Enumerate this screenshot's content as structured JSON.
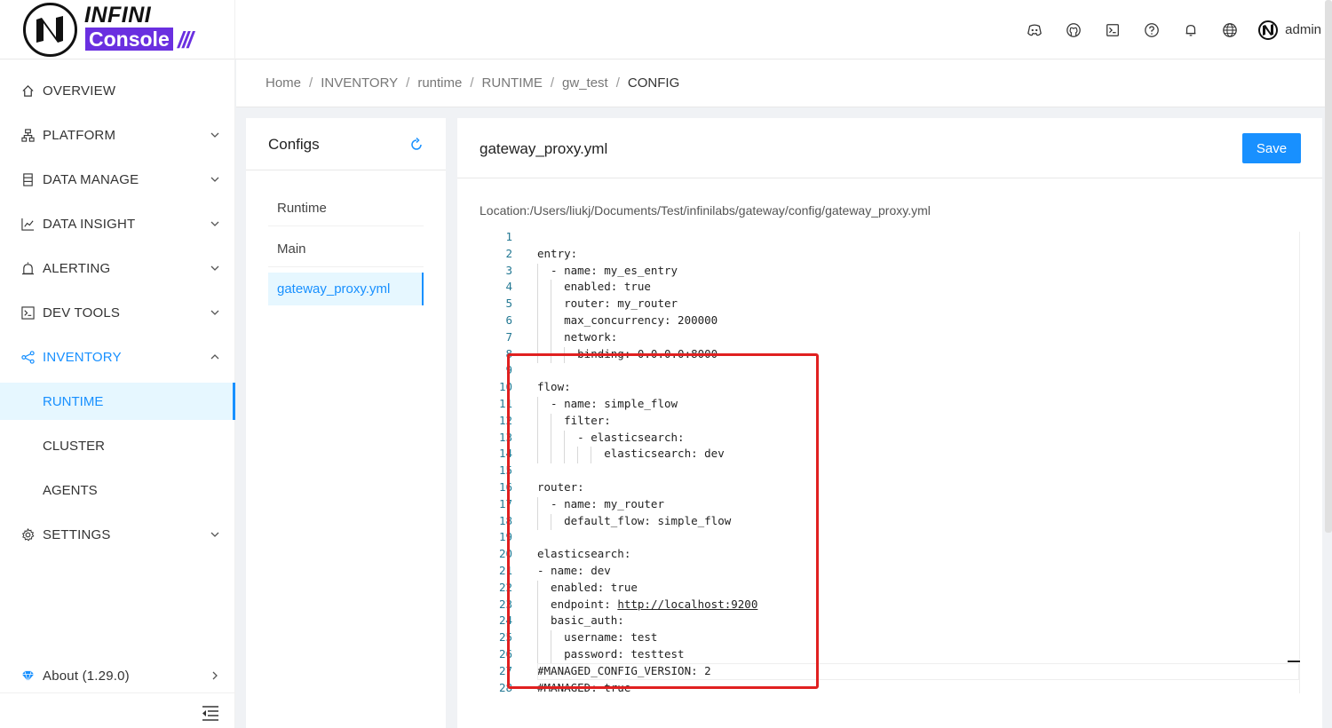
{
  "app": {
    "logo_top": "INFINI",
    "logo_bottom": "Console",
    "logo_slashes": "///"
  },
  "header": {
    "icons": [
      "discord-icon",
      "github-icon",
      "terminal-icon",
      "help-icon",
      "bell-icon",
      "globe-icon"
    ],
    "user": "admin"
  },
  "sidebar": {
    "items": [
      {
        "label": "OVERVIEW",
        "icon": "home-icon"
      },
      {
        "label": "PLATFORM",
        "icon": "cluster-icon"
      },
      {
        "label": "DATA MANAGE",
        "icon": "database-icon"
      },
      {
        "label": "DATA INSIGHT",
        "icon": "chart-icon"
      },
      {
        "label": "ALERTING",
        "icon": "alarm-icon"
      },
      {
        "label": "DEV TOOLS",
        "icon": "code-icon"
      },
      {
        "label": "INVENTORY",
        "icon": "share-icon"
      },
      {
        "label": "SETTINGS",
        "icon": "gear-icon"
      }
    ],
    "inventory_children": [
      "RUNTIME",
      "CLUSTER",
      "AGENTS"
    ],
    "about": "About (1.29.0)"
  },
  "breadcrumb": [
    "Home",
    "INVENTORY",
    "runtime",
    "RUNTIME",
    "gw_test",
    "CONFIG"
  ],
  "configs": {
    "title": "Configs",
    "items": [
      "Runtime",
      "Main",
      "gateway_proxy.yml"
    ],
    "selected": "gateway_proxy.yml"
  },
  "editor": {
    "filename": "gateway_proxy.yml",
    "save_label": "Save",
    "location": "Location:/Users/liukj/Documents/Test/infinilabs/gateway/config/gateway_proxy.yml",
    "lines": [
      "",
      "entry:",
      "  - name: my_es_entry",
      "    enabled: true",
      "    router: my_router",
      "    max_concurrency: 200000",
      "    network:",
      "      binding: 0.0.0.0:8000",
      "",
      "flow:",
      "  - name: simple_flow",
      "    filter:",
      "      - elasticsearch:",
      "          elasticsearch: dev",
      "",
      "router:",
      "  - name: my_router",
      "    default_flow: simple_flow",
      "",
      "elasticsearch:",
      "- name: dev",
      "  enabled: true",
      "  endpoint: http://localhost:9200",
      "  basic_auth:",
      "    username: test",
      "    password: testtest",
      "#MANAGED_CONFIG_VERSION: 2",
      "#MANAGED: true"
    ]
  },
  "colors": {
    "accent": "#1890ff",
    "brand": "#6a2fe0",
    "highlight": "#e02020"
  }
}
